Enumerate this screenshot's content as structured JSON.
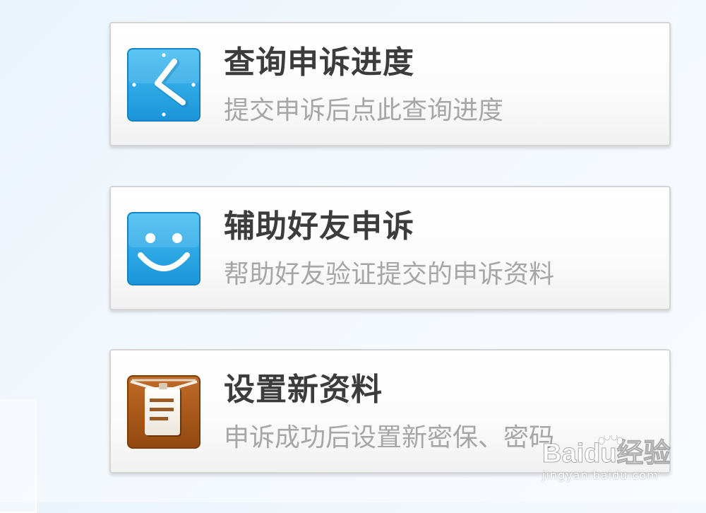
{
  "cards": [
    {
      "title": "查询申诉进度",
      "description": "提交申诉后点此查询进度",
      "icon": "clock-icon",
      "icon_color": "#29a6e4"
    },
    {
      "title": "辅助好友申诉",
      "description": "帮助好友验证提交的申诉资料",
      "icon": "smiley-icon",
      "icon_color": "#29a6e4"
    },
    {
      "title": "设置新资料",
      "description": "申诉成功后设置新密保、密码",
      "icon": "clipboard-icon",
      "icon_color": "#a5561e"
    }
  ],
  "watermark": {
    "logo_text": "Baidu经验",
    "url": "jingyan.baidu.com"
  },
  "colors": {
    "title": "#3c3c3c",
    "description": "#a6a6a6",
    "card_border": "#d4d4d4",
    "background": "#eef5fc"
  }
}
